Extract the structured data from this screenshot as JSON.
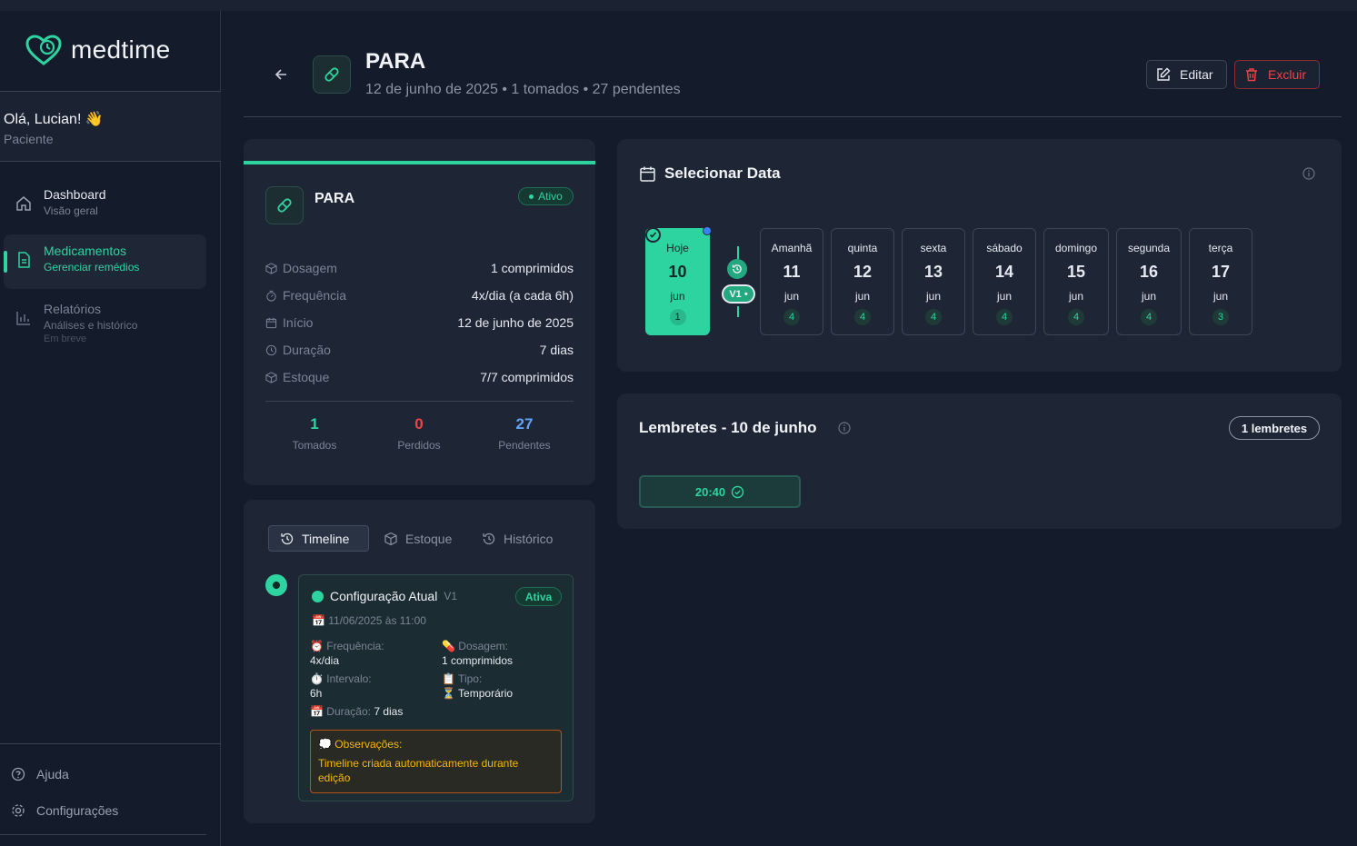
{
  "app": {
    "logo_text": "medtime"
  },
  "user": {
    "greeting": "Olá, Lucian! 👋",
    "role": "Paciente"
  },
  "nav": [
    {
      "label": "Dashboard",
      "sub": "Visão geral"
    },
    {
      "label": "Medicamentos",
      "sub": "Gerenciar remédios"
    },
    {
      "label": "Relatórios",
      "sub": "Análises e histórico",
      "note": "Em breve"
    }
  ],
  "sidebar_bottom": {
    "help": "Ajuda",
    "settings": "Configurações"
  },
  "header": {
    "title": "PARA",
    "subtitle": "12 de junho de 2025 • 1 tomados • 27 pendentes",
    "edit_label": "Editar",
    "delete_label": "Excluir"
  },
  "med": {
    "name": "PARA",
    "status": "Ativo",
    "rows": [
      {
        "label": "Dosagem",
        "value": "1 comprimidos",
        "icon": "box-icon"
      },
      {
        "label": "Frequência",
        "value": "4x/dia (a cada 6h)",
        "icon": "timer-icon"
      },
      {
        "label": "Início",
        "value": "12 de junho de 2025",
        "icon": "calendar-icon"
      },
      {
        "label": "Duração",
        "value": "7 dias",
        "icon": "clock-icon"
      },
      {
        "label": "Estoque",
        "value": "7/7 comprimidos",
        "icon": "box-icon"
      }
    ],
    "stats": [
      {
        "value": "1",
        "label": "Tomados",
        "color": "#2dd4a0"
      },
      {
        "value": "0",
        "label": "Perdidos",
        "color": "#ef4444"
      },
      {
        "value": "27",
        "label": "Pendentes",
        "color": "#60a5fa"
      }
    ]
  },
  "tabs": [
    "Timeline",
    "Estoque",
    "Histórico"
  ],
  "timeline": {
    "title": "Configuração Atual",
    "version": "V1",
    "status": "Ativa",
    "date": "📅 11/06/2025 às 11:00",
    "freq_label": "⏰ Frequência:",
    "freq_value": "4x/dia",
    "dose_label": "💊 Dosagem:",
    "dose_value": "1 comprimidos",
    "interval_label": "⏱️ Intervalo:",
    "interval_value": "6h",
    "type_label": "📋 Tipo:",
    "type_value": "⏳ Temporário",
    "duration_label": "📅 Duração:",
    "duration_value": "7 dias",
    "obs_label": "💭 Observações:",
    "obs_text": "Timeline criada automaticamente durante edição"
  },
  "date_select": {
    "title": "Selecionar Data",
    "version_pill": "V1 •",
    "days": [
      {
        "name": "Hoje",
        "day": "10",
        "month": "jun",
        "count": "1"
      },
      {
        "name": "Amanhã",
        "day": "11",
        "month": "jun",
        "count": "4"
      },
      {
        "name": "quinta",
        "day": "12",
        "month": "jun",
        "count": "4"
      },
      {
        "name": "sexta",
        "day": "13",
        "month": "jun",
        "count": "4"
      },
      {
        "name": "sábado",
        "day": "14",
        "month": "jun",
        "count": "4"
      },
      {
        "name": "domingo",
        "day": "15",
        "month": "jun",
        "count": "4"
      },
      {
        "name": "segunda",
        "day": "16",
        "month": "jun",
        "count": "4"
      },
      {
        "name": "terça",
        "day": "17",
        "month": "jun",
        "count": "3"
      }
    ]
  },
  "reminders": {
    "title": "Lembretes - 10 de junho",
    "badge": "1 lembretes",
    "times": [
      "20:40"
    ]
  },
  "colors": {
    "accent": "#2dd4a0",
    "danger": "#ef4444",
    "info": "#60a5fa",
    "warning": "#f5b800"
  }
}
